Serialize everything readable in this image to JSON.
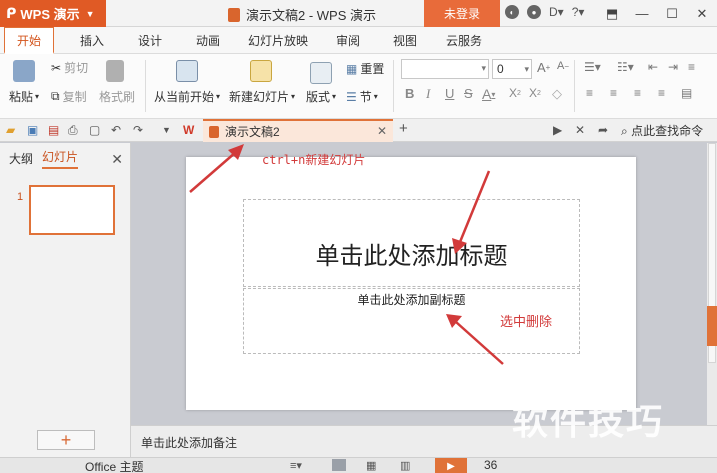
{
  "titlebar": {
    "app_name": "WPS 演示",
    "doc_title": "演示文稿2 - WPS 演示",
    "login_label": "未登录",
    "help_label": "?"
  },
  "menu": {
    "tabs": [
      "开始",
      "插入",
      "设计",
      "动画",
      "幻灯片放映",
      "审阅",
      "视图",
      "云服务"
    ]
  },
  "ribbon": {
    "paste": "粘贴",
    "cut": "剪切",
    "copy": "复制",
    "format_painter": "格式刷",
    "from_current": "从当前开始",
    "new_slide": "新建幻灯片",
    "layout": "版式",
    "reset": "重置",
    "section": "节",
    "font_size": "0"
  },
  "doc_tab": {
    "name": "演示文稿2",
    "search_placeholder": "点此查找命令"
  },
  "left_panel": {
    "tab_outline": "大纲",
    "tab_slides": "幻灯片",
    "slide_number": "1"
  },
  "slide": {
    "title_placeholder": "单击此处添加标题",
    "subtitle_placeholder": "单击此处添加副标题"
  },
  "notes": {
    "placeholder": "单击此处添加备注"
  },
  "statusbar": {
    "theme": "Office 主题",
    "zoom": "36"
  },
  "annotations": {
    "shortcut": "ctrl+n新建幻灯片",
    "delete_hint": "选中删除",
    "watermark": "软件技巧"
  },
  "colors": {
    "accent": "#e07238",
    "annotation": "#d23a3a"
  }
}
